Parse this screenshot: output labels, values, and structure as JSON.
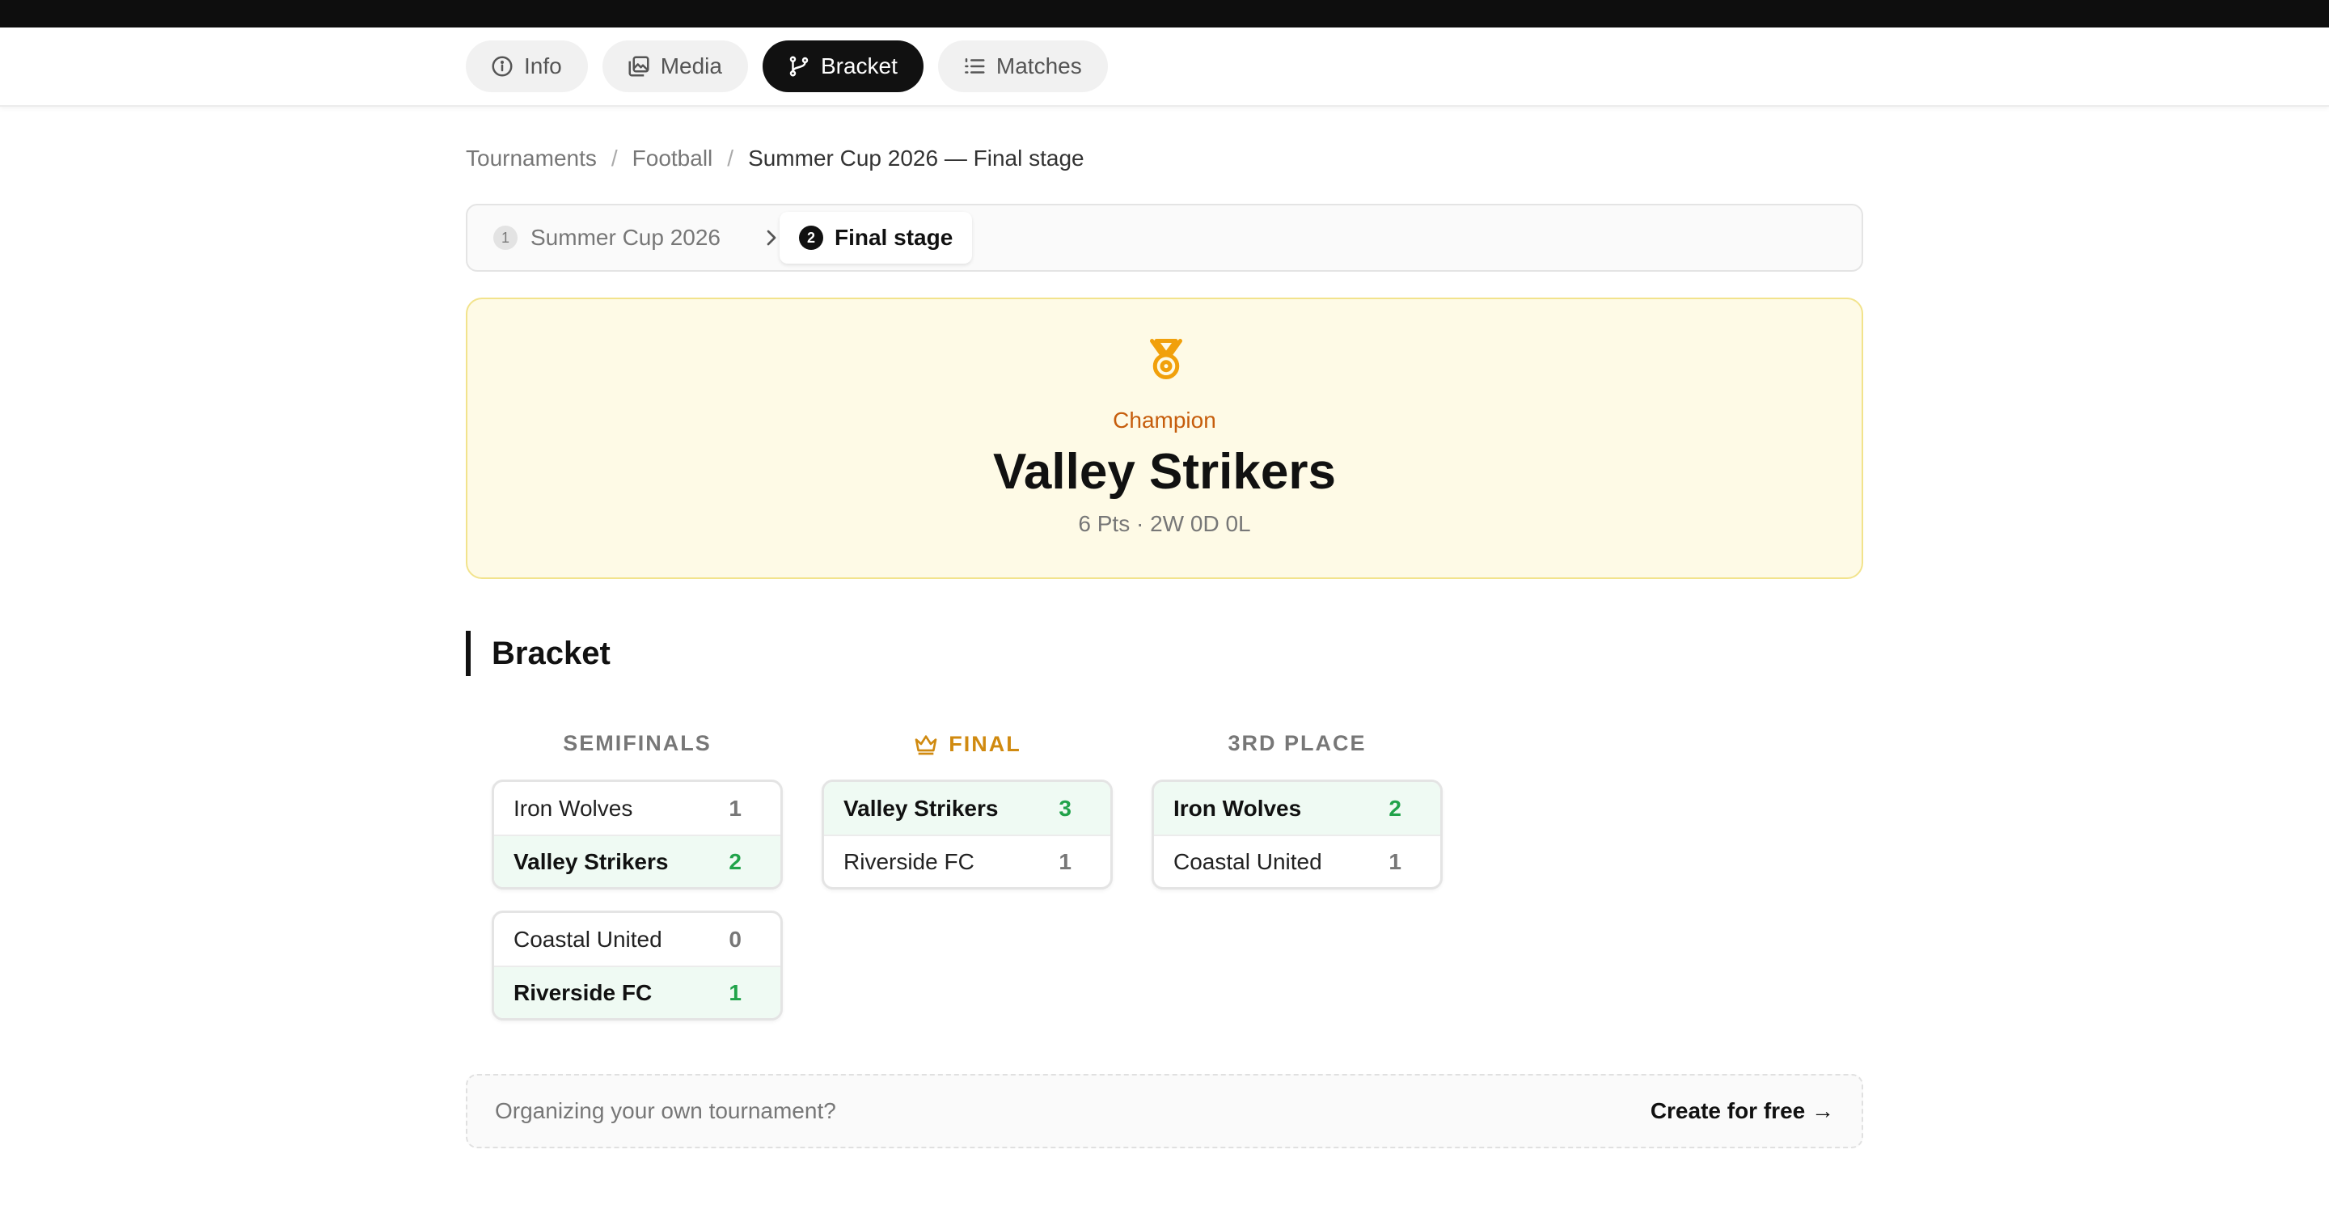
{
  "nav": {
    "tabs": [
      {
        "label": "Info",
        "icon": "info-icon"
      },
      {
        "label": "Media",
        "icon": "media-icon"
      },
      {
        "label": "Bracket",
        "icon": "bracket-icon",
        "active": true
      },
      {
        "label": "Matches",
        "icon": "list-icon"
      }
    ]
  },
  "breadcrumb": [
    "Tournaments",
    "Football",
    "Summer Cup 2026 — Final stage"
  ],
  "stepper": {
    "steps": [
      {
        "num": "1",
        "label": "Summer Cup 2026"
      },
      {
        "num": "2",
        "label": "Final stage",
        "active": true
      }
    ]
  },
  "champion": {
    "label": "Champion",
    "name": "Valley Strikers",
    "stats": "6 Pts · 2W 0D 0L",
    "icon": "medal-icon"
  },
  "bracket": {
    "title": "Bracket",
    "columns": {
      "semifinals": "SEMIFINALS",
      "final": "FINAL",
      "third": "3RD PLACE"
    },
    "semifinals": [
      {
        "teams": [
          {
            "name": "Iron Wolves",
            "score": "1"
          },
          {
            "name": "Valley Strikers",
            "score": "2",
            "winner": true
          }
        ]
      },
      {
        "teams": [
          {
            "name": "Coastal United",
            "score": "0"
          },
          {
            "name": "Riverside FC",
            "score": "1",
            "winner": true
          }
        ]
      }
    ],
    "final": {
      "teams": [
        {
          "name": "Valley Strikers",
          "score": "3",
          "winner": true
        },
        {
          "name": "Riverside FC",
          "score": "1"
        }
      ]
    },
    "third": {
      "teams": [
        {
          "name": "Iron Wolves",
          "score": "2",
          "winner": true
        },
        {
          "name": "Coastal United",
          "score": "1"
        }
      ]
    }
  },
  "cta": {
    "text": "Organizing your own tournament?",
    "link": "Create for free →"
  },
  "colors": {
    "accent": "#111111",
    "champion_bg": "#fefae6",
    "champion_label": "#c65d0c",
    "winner_score": "#21a34a",
    "final_header": "#d08a10"
  }
}
